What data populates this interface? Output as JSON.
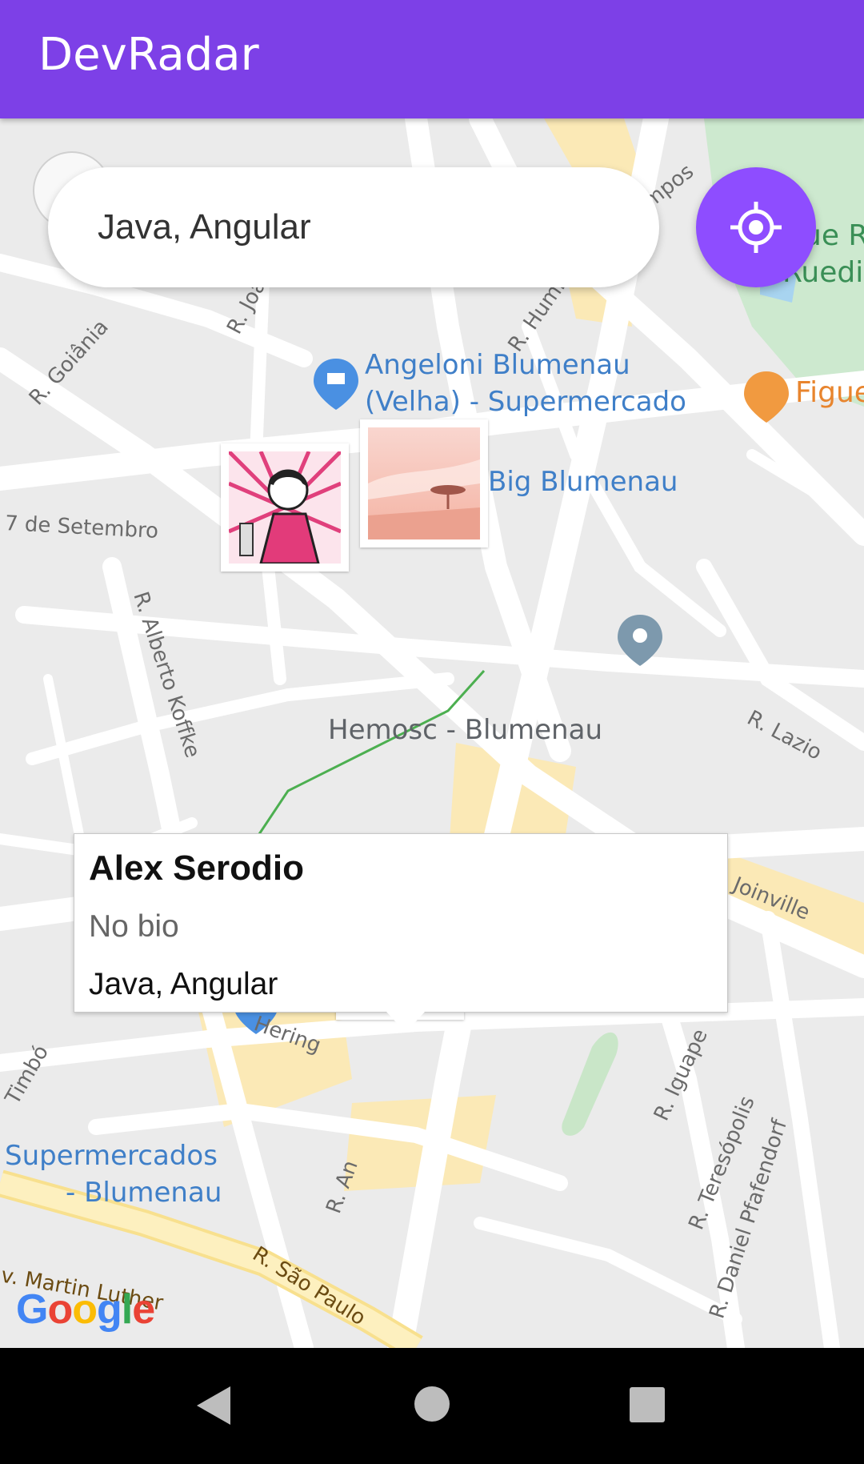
{
  "app": {
    "title": "DevRadar"
  },
  "search": {
    "value": "Java, Angular"
  },
  "map": {
    "labels": {
      "angeloni_line1": "Angeloni Blumenau",
      "angeloni_line2": "(Velha) - Supermercado",
      "big_blumenau": "Big Blumenau",
      "hemosc": "Hemosc - Blumenau",
      "supermercados_line1": "Supermercados",
      "supermercados_line2": "- Blumenau",
      "figue": "Figue",
      "ruedi_line1": "ue R",
      "ruedi_line2": "Ruedi",
      "campos": "mpos",
      "r_goiania": "R. Goiânia",
      "r_joa": "R. Joa",
      "r_humb": "R. Humb",
      "sete_setembro": "7 de Setembro",
      "r_alberto_koffke": "R. Alberto Koffke",
      "r_lazio": "R. Lazio",
      "joinville": "Joinville",
      "hering": "Hering",
      "timbo": "Timbó",
      "r_iguape": "R. Iguape",
      "r_teresopolis": "R. Teresópolis",
      "r_daniel_pfafendorf": "R. Daniel Pfafendorf",
      "r_sao_paulo": "R. São Paulo",
      "r_an": "R. An",
      "av_martin": "v. Martin Luther"
    },
    "google_logo": "Google"
  },
  "callout": {
    "name": "Alex Serodio",
    "bio": "No bio",
    "techs": "Java, Angular"
  },
  "colors": {
    "primary": "#7d40e7",
    "button": "#8e4dff"
  }
}
